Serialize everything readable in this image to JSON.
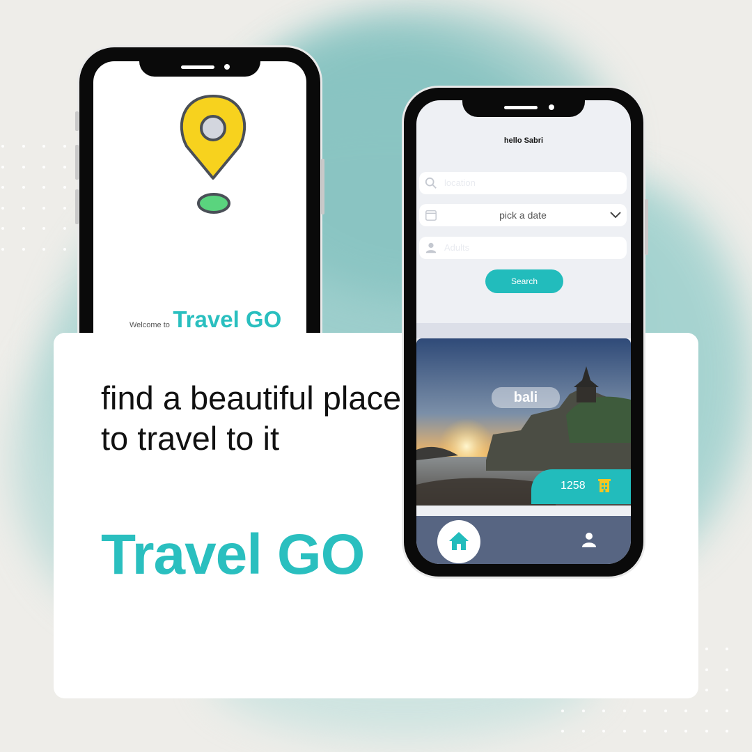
{
  "promo": {
    "tagline": "find a beautiful place to travel to it",
    "brand": "Travel GO"
  },
  "splash_screen": {
    "welcome_prefix": "Welcome to",
    "brand": "Travel GO",
    "icon": "location-pin-icon"
  },
  "home_screen": {
    "greeting": "hello Sabri",
    "location_placeholder": "location",
    "date_label": "pick a date",
    "adults_placeholder": "Adults",
    "search_label": "Search",
    "destination": {
      "name": "bali",
      "count": "1258",
      "count_icon": "hotel-icon"
    },
    "nav": {
      "home_icon": "home-icon",
      "profile_icon": "user-icon"
    }
  },
  "colors": {
    "accent": "#2abfbf",
    "button": "#22bcbc",
    "navbar": "#576582",
    "pin_yellow": "#f7d21e",
    "pin_green": "#5ad47e"
  }
}
